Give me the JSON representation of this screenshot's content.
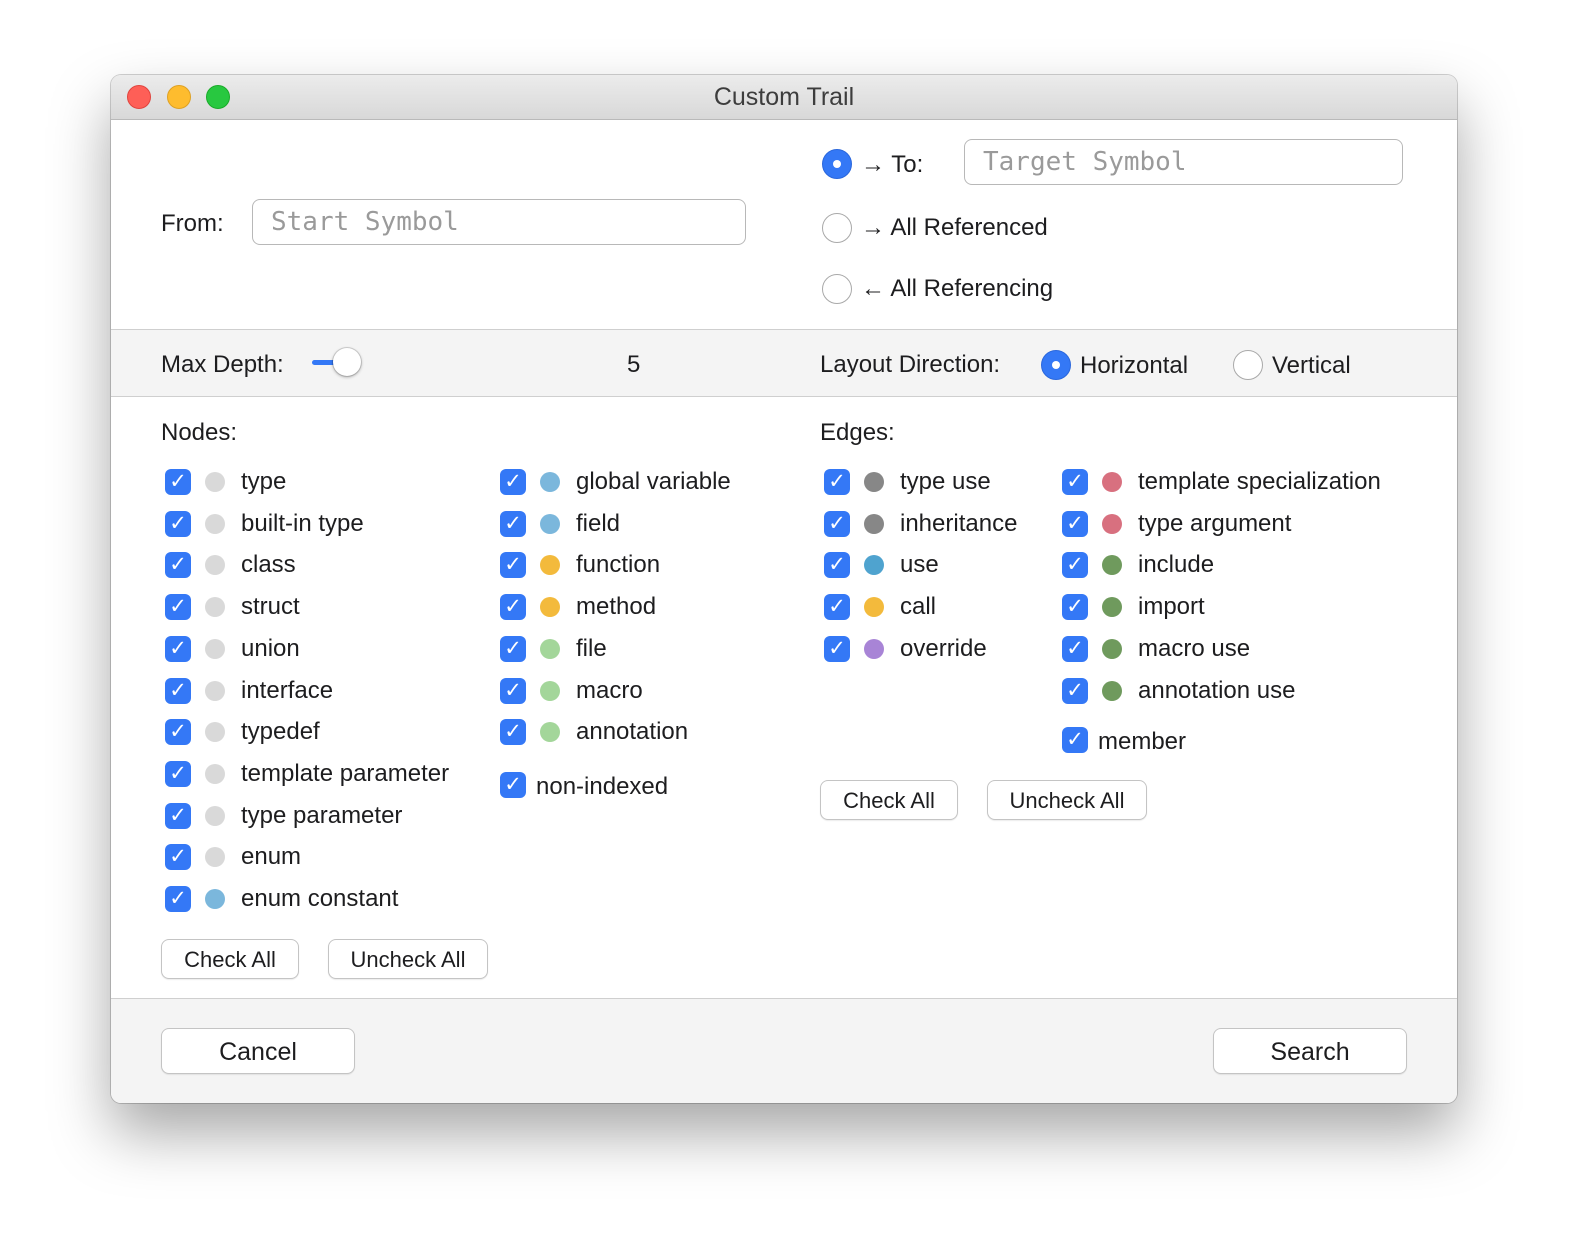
{
  "window": {
    "title": "Custom Trail",
    "controls": [
      "close-button",
      "minimize-button",
      "zoom-button"
    ]
  },
  "from": {
    "label": "From:",
    "placeholder": "Start Symbol",
    "value": ""
  },
  "direction": {
    "selected": "to",
    "options": [
      {
        "id": "to",
        "label": "→ To:",
        "selected": true
      },
      {
        "id": "all-referenced",
        "label": "→ All Referenced",
        "selected": false
      },
      {
        "id": "all-referencing",
        "label": "← All Referencing",
        "selected": false
      }
    ],
    "target": {
      "placeholder": "Target Symbol",
      "value": ""
    }
  },
  "depth": {
    "label": "Max Depth:",
    "value": "5",
    "slider_fraction": 0.05
  },
  "layout": {
    "label": "Layout Direction:",
    "options": [
      {
        "label": "Horizontal",
        "selected": true
      },
      {
        "label": "Vertical",
        "selected": false
      }
    ]
  },
  "nodes": {
    "header": "Nodes:",
    "col1": [
      {
        "label": "type",
        "checked": true,
        "color": "#d9d9d9"
      },
      {
        "label": "built-in type",
        "checked": true,
        "color": "#d9d9d9"
      },
      {
        "label": "class",
        "checked": true,
        "color": "#d9d9d9"
      },
      {
        "label": "struct",
        "checked": true,
        "color": "#d9d9d9"
      },
      {
        "label": "union",
        "checked": true,
        "color": "#d9d9d9"
      },
      {
        "label": "interface",
        "checked": true,
        "color": "#d9d9d9"
      },
      {
        "label": "typedef",
        "checked": true,
        "color": "#d9d9d9"
      },
      {
        "label": "template parameter",
        "checked": true,
        "color": "#d9d9d9"
      },
      {
        "label": "type parameter",
        "checked": true,
        "color": "#d9d9d9"
      },
      {
        "label": "enum",
        "checked": true,
        "color": "#d9d9d9"
      },
      {
        "label": "enum constant",
        "checked": true,
        "color": "#7bb7dc"
      }
    ],
    "col2": [
      {
        "label": "global variable",
        "checked": true,
        "color": "#7bb7dc"
      },
      {
        "label": "field",
        "checked": true,
        "color": "#7bb7dc"
      },
      {
        "label": "function",
        "checked": true,
        "color": "#f3ba3c"
      },
      {
        "label": "method",
        "checked": true,
        "color": "#f3ba3c"
      },
      {
        "label": "file",
        "checked": true,
        "color": "#a3d69a"
      },
      {
        "label": "macro",
        "checked": true,
        "color": "#a3d69a"
      },
      {
        "label": "annotation",
        "checked": true,
        "color": "#a3d69a"
      }
    ],
    "extra": {
      "label": "non-indexed",
      "checked": true
    },
    "check_all": "Check All",
    "uncheck_all": "Uncheck All"
  },
  "edges": {
    "header": "Edges:",
    "col1": [
      {
        "label": "type use",
        "checked": true,
        "color": "#878787"
      },
      {
        "label": "inheritance",
        "checked": true,
        "color": "#878787"
      },
      {
        "label": "use",
        "checked": true,
        "color": "#4fa3cf"
      },
      {
        "label": "call",
        "checked": true,
        "color": "#f3ba3c"
      },
      {
        "label": "override",
        "checked": true,
        "color": "#a884d6"
      }
    ],
    "col2": [
      {
        "label": "template specialization",
        "checked": true,
        "color": "#d8707f"
      },
      {
        "label": "type argument",
        "checked": true,
        "color": "#d8707f"
      },
      {
        "label": "include",
        "checked": true,
        "color": "#6f9a5d"
      },
      {
        "label": "import",
        "checked": true,
        "color": "#6f9a5d"
      },
      {
        "label": "macro use",
        "checked": true,
        "color": "#6f9a5d"
      },
      {
        "label": "annotation use",
        "checked": true,
        "color": "#6f9a5d"
      }
    ],
    "extra": {
      "label": "member",
      "checked": true
    },
    "check_all": "Check All",
    "uncheck_all": "Uncheck All"
  },
  "footer": {
    "cancel": "Cancel",
    "search": "Search"
  },
  "colors": {
    "accent": "#3478f6"
  }
}
